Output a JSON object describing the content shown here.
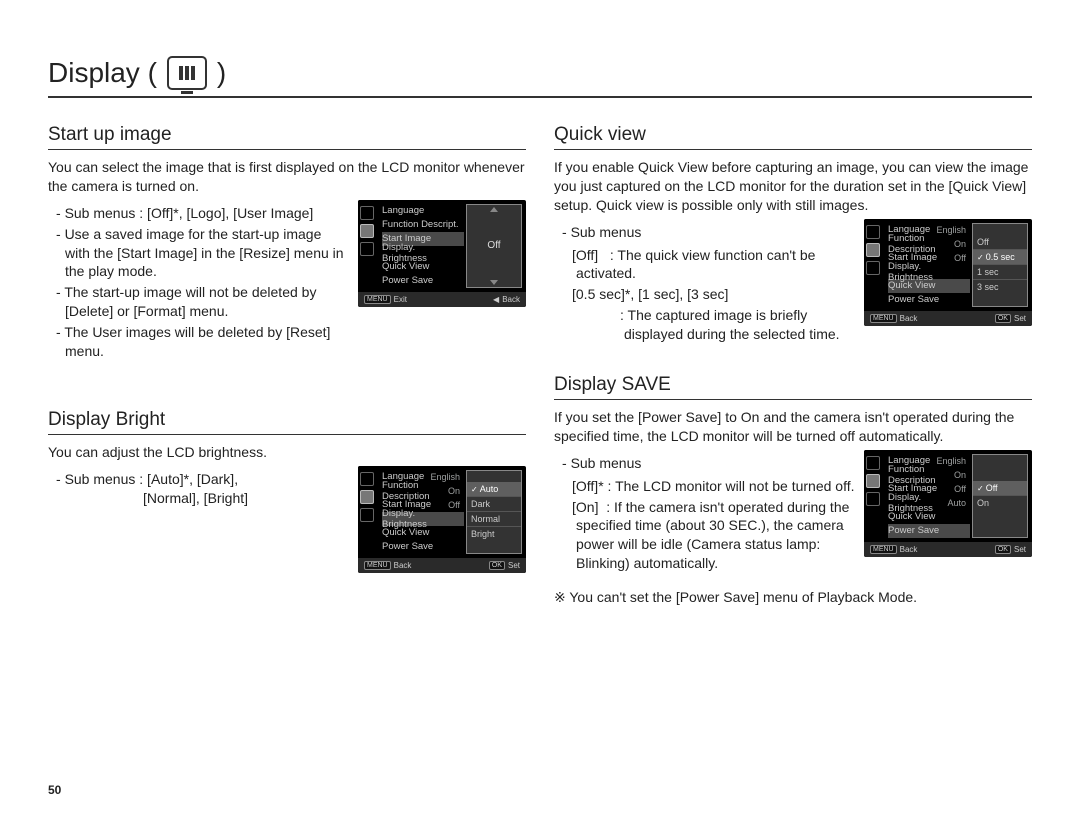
{
  "page_number": "50",
  "main_title": "Display (",
  "main_title_close": " )",
  "sections": {
    "startup": {
      "title": "Start up image",
      "intro": "You can select the image that is first displayed on the LCD monitor whenever the camera is turned on.",
      "bullets": [
        "Sub menus : [Off]*, [Logo], [User Image]",
        "Use a saved image for the start-up image with the [Start Image] in the [Resize] menu in the play mode.",
        "The start-up image will not be deleted by [Delete] or [Format] menu.",
        "The User images will be deleted by [Reset] menu."
      ],
      "lcd": {
        "rows": [
          {
            "label": "Language",
            "value": ""
          },
          {
            "label": "Function Descript.",
            "value": ""
          },
          {
            "label": "Start Image",
            "value": "",
            "active": true
          },
          {
            "label": "Display. Brightness",
            "value": ""
          },
          {
            "label": "Quick View",
            "value": ""
          },
          {
            "label": "Power Save",
            "value": ""
          }
        ],
        "right_single": "Off",
        "footer_left_key": "MENU",
        "footer_left": "Exit",
        "footer_right_glyph": "◀",
        "footer_right": "Back"
      }
    },
    "bright": {
      "title": "Display Bright",
      "intro": "You can adjust the LCD brightness.",
      "bullets_line1": "Sub menus : [Auto]*, [Dark],",
      "bullets_line2": "[Normal], [Bright]",
      "lcd": {
        "rows": [
          {
            "label": "Language",
            "value": "English"
          },
          {
            "label": "Function Description",
            "value": "On"
          },
          {
            "label": "Start Image",
            "value": "Off"
          },
          {
            "label": "Display. Brightness",
            "value": "",
            "active": true
          },
          {
            "label": "Quick View",
            "value": ""
          },
          {
            "label": "Power Save",
            "value": ""
          }
        ],
        "options": [
          {
            "label": "Auto",
            "selected": true
          },
          {
            "label": "Dark"
          },
          {
            "label": "Normal"
          },
          {
            "label": "Bright"
          }
        ],
        "footer_left_key": "MENU",
        "footer_left": "Back",
        "footer_right_key": "OK",
        "footer_right": "Set"
      }
    },
    "quick": {
      "title": "Quick view",
      "intro": "If you enable Quick View before capturing an image, you can view the image you just captured on the LCD monitor for the duration set in the [Quick View] setup. Quick view is possible only with still images.",
      "sub_label": "Sub menus",
      "items": [
        {
          "key": "[Off]",
          "desc": ": The quick view function can't be activated."
        },
        {
          "key": "[0.5 sec]*, [1 sec], [3 sec]",
          "desc": ""
        },
        {
          "key": "",
          "desc": ": The captured image is briefly displayed during the selected time."
        }
      ],
      "lcd": {
        "rows": [
          {
            "label": "Language",
            "value": "English"
          },
          {
            "label": "Function Description",
            "value": "On"
          },
          {
            "label": "Start Image",
            "value": "Off"
          },
          {
            "label": "Display. Brightness",
            "value": ""
          },
          {
            "label": "Quick View",
            "value": "",
            "active": true
          },
          {
            "label": "Power Save",
            "value": ""
          }
        ],
        "options": [
          {
            "label": "Off"
          },
          {
            "label": "0.5 sec",
            "selected": true
          },
          {
            "label": "1 sec"
          },
          {
            "label": "3 sec"
          }
        ],
        "footer_left_key": "MENU",
        "footer_left": "Back",
        "footer_right_key": "OK",
        "footer_right": "Set"
      }
    },
    "save": {
      "title": "Display SAVE",
      "intro": "If you set the [Power Save] to On and the camera isn't operated during the specified time, the LCD monitor will be turned off automatically.",
      "sub_label": "Sub menus",
      "items": [
        {
          "key": "[Off]*",
          "desc": ": The LCD monitor will not be turned off."
        },
        {
          "key": "[On]",
          "desc": ": If the camera isn't operated during the specified time (about 30 SEC.), the camera power will be idle (Camera status lamp: Blinking) automatically."
        }
      ],
      "note": "※ You can't set the [Power Save] menu of Playback Mode.",
      "lcd": {
        "rows": [
          {
            "label": "Language",
            "value": "English"
          },
          {
            "label": "Function Description",
            "value": "On"
          },
          {
            "label": "Start Image",
            "value": "Off"
          },
          {
            "label": "Display. Brightness",
            "value": "Auto"
          },
          {
            "label": "Quick View",
            "value": ""
          },
          {
            "label": "Power Save",
            "value": "",
            "active": true
          }
        ],
        "options": [
          {
            "label": "Off",
            "selected": true
          },
          {
            "label": "On"
          }
        ],
        "footer_left_key": "MENU",
        "footer_left": "Back",
        "footer_right_key": "OK",
        "footer_right": "Set"
      }
    }
  }
}
